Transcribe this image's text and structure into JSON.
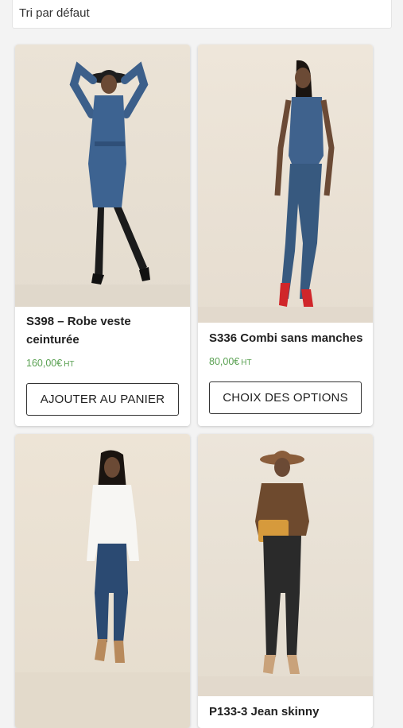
{
  "sort": {
    "label": "Tri par défaut"
  },
  "products": [
    {
      "title": "S398 – Robe veste ceinturée",
      "price": "160,00€",
      "unit": "HT",
      "button": "AJOUTER AU PANIER"
    },
    {
      "title": "S336 Combi sans manches",
      "price": "80,00€",
      "unit": "HT",
      "button": "CHOIX DES OPTIONS"
    },
    {
      "title": "",
      "price": "",
      "unit": "",
      "button": ""
    },
    {
      "title": "P133-3 Jean skinny",
      "price": "",
      "unit": "",
      "button": ""
    }
  ],
  "colors": {
    "price_green": "#5aa152",
    "photo_bg": "#ece6dc"
  }
}
